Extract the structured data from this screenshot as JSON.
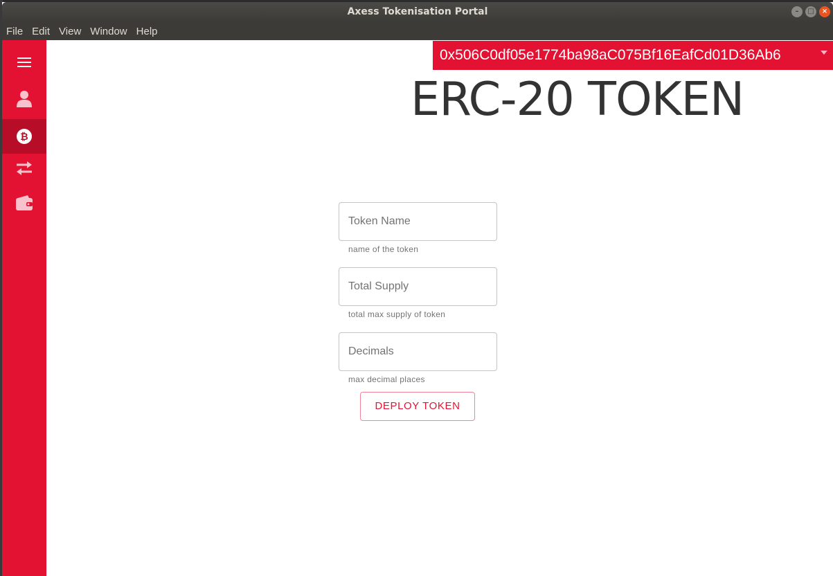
{
  "window": {
    "title": "Axess Tokenisation Portal",
    "controls": [
      "minimize",
      "maximize",
      "close"
    ]
  },
  "menubar": {
    "items": [
      "File",
      "Edit",
      "View",
      "Window",
      "Help"
    ]
  },
  "sidebar": {
    "items": [
      {
        "name": "menu",
        "icon": "hamburger-menu-icon",
        "active": false
      },
      {
        "name": "profile",
        "icon": "user-icon",
        "active": false
      },
      {
        "name": "token",
        "icon": "bitcoin-icon",
        "active": true
      },
      {
        "name": "transfer",
        "icon": "transfer-arrows-icon",
        "active": false
      },
      {
        "name": "wallet",
        "icon": "wallet-icon",
        "active": false
      }
    ]
  },
  "header": {
    "account_address": "0x506C0df05e1774ba98aC075Bf16EafCd01D36Ab6"
  },
  "main": {
    "title": "ERC-20 TOKEN",
    "fields": [
      {
        "placeholder": "Token Name",
        "value": "",
        "helper": "name of the token"
      },
      {
        "placeholder": "Total Supply",
        "value": "",
        "helper": "total max supply of token"
      },
      {
        "placeholder": "Decimals",
        "value": "",
        "helper": "max decimal places"
      }
    ],
    "deploy_label": "DEPLOY TOKEN"
  },
  "colors": {
    "brand_red": "#e31233",
    "brand_red_active": "#b80d28",
    "titlebar": "#3c3b37",
    "close_button": "#e95420"
  }
}
